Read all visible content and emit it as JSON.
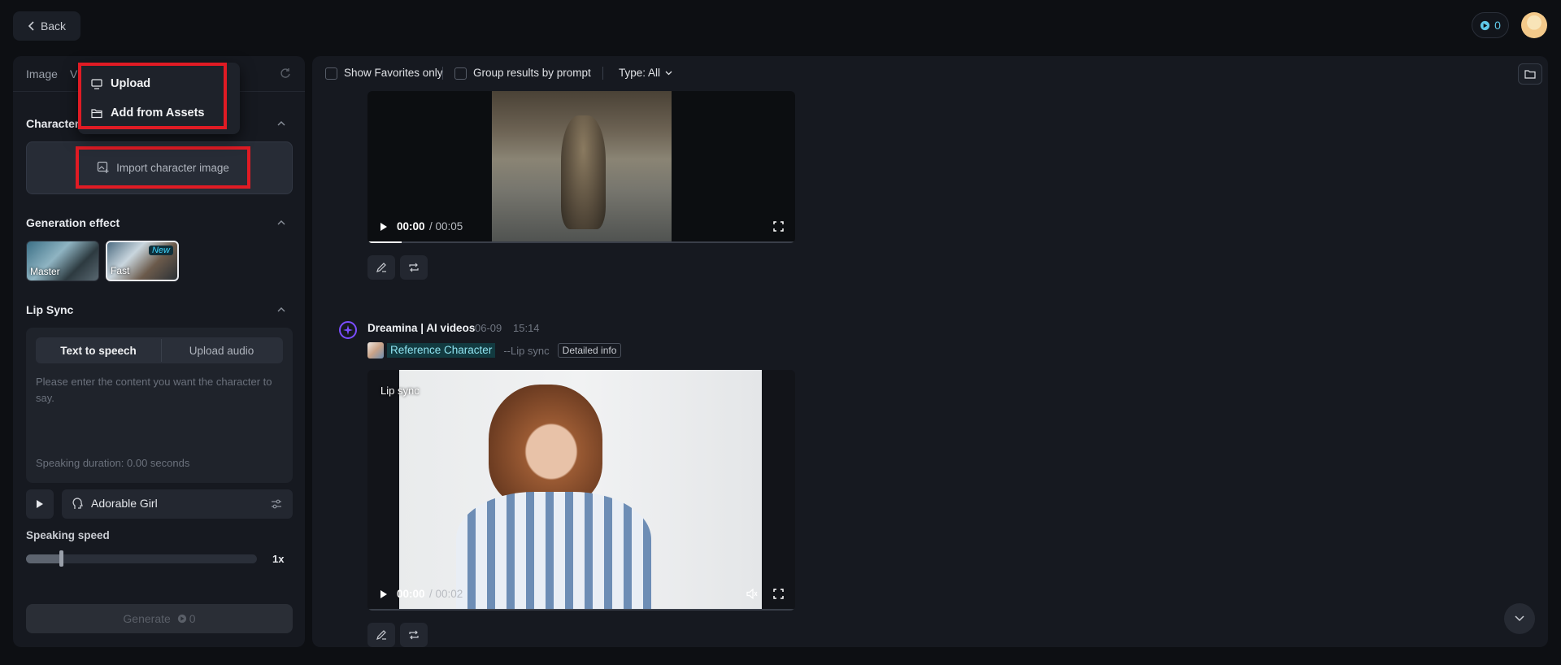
{
  "header": {
    "back_label": "Back",
    "credits": "0"
  },
  "left": {
    "tabs": [
      "Image",
      "Vi"
    ],
    "character_title": "Character",
    "import_label": "Import character image",
    "generation_title": "Generation effect",
    "effects": [
      {
        "label": "Master"
      },
      {
        "label": "Fast",
        "badge": "New"
      }
    ],
    "lipsync_title": "Lip Sync",
    "seg_tts": "Text to speech",
    "seg_upload": "Upload audio",
    "placeholder": "Please enter the content you want the character to say.",
    "duration": "Speaking duration: 0.00 seconds",
    "voice": "Adorable Girl",
    "speed_label": "Speaking speed",
    "speed_value": "1x",
    "speed_fraction": 0.15,
    "generate_label": "Generate",
    "generate_cost": "0"
  },
  "dropdown": {
    "upload": "Upload",
    "assets": "Add from Assets"
  },
  "filters": {
    "favorites": "Show Favorites only",
    "group": "Group results by prompt",
    "type": "Type: All"
  },
  "video1": {
    "current": "00:00",
    "total": "/ 00:05"
  },
  "entry2": {
    "agent": "Dreamina | AI videos",
    "date": "06-09",
    "time": "15:14",
    "ref": "Reference Character",
    "mode": "--Lip sync",
    "detail": "Detailed info",
    "overlay": "Lip sync",
    "current": "00:00",
    "total": "/ 00:02"
  },
  "colors": {
    "accent_red": "#e01b24",
    "credits_blue": "#5fc8e8",
    "agent_purple": "#7a4dff"
  }
}
